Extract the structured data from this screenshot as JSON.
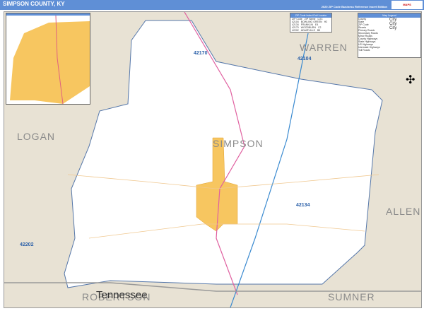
{
  "header": {
    "title": "SIMPSON COUNTY, KY",
    "subtitle": "2020 ZIP Code Business Reference Insert Edition",
    "logo": "MAPS"
  },
  "labels": {
    "county": "SIMPSON",
    "warren": "WARREN",
    "logan": "LOGAN",
    "allen": "ALLEN",
    "sumner": "SUMNER",
    "robertson": "ROBERTSON",
    "tennessee": "Tennessee"
  },
  "zips": [
    "42170",
    "42104",
    "42134",
    "42202"
  ],
  "zip_table": {
    "title": "ZIP Code Index/Grid Locator",
    "headers": [
      "ZIP Code",
      "ZIP Name",
      "LOC"
    ],
    "rows": [
      [
        "42104",
        "BOWLING GREEN",
        "H2"
      ],
      [
        "42134",
        "FRANKLIN",
        "E4"
      ],
      [
        "42170",
        "WOODBURN",
        "C2"
      ],
      [
        "42202",
        "ADAIRVILLE",
        "B5"
      ]
    ]
  },
  "legend": {
    "title": "Map Legend",
    "items": [
      "County",
      "State",
      "ZIP Code",
      "Streets",
      "Primary Roads",
      "Secondary Roads",
      "Minor Roads",
      "County Highways",
      "State Highways",
      "US Highways",
      "Interstate Highways",
      "Toll Roads"
    ],
    "cities": [
      "City",
      "City",
      "City"
    ]
  }
}
